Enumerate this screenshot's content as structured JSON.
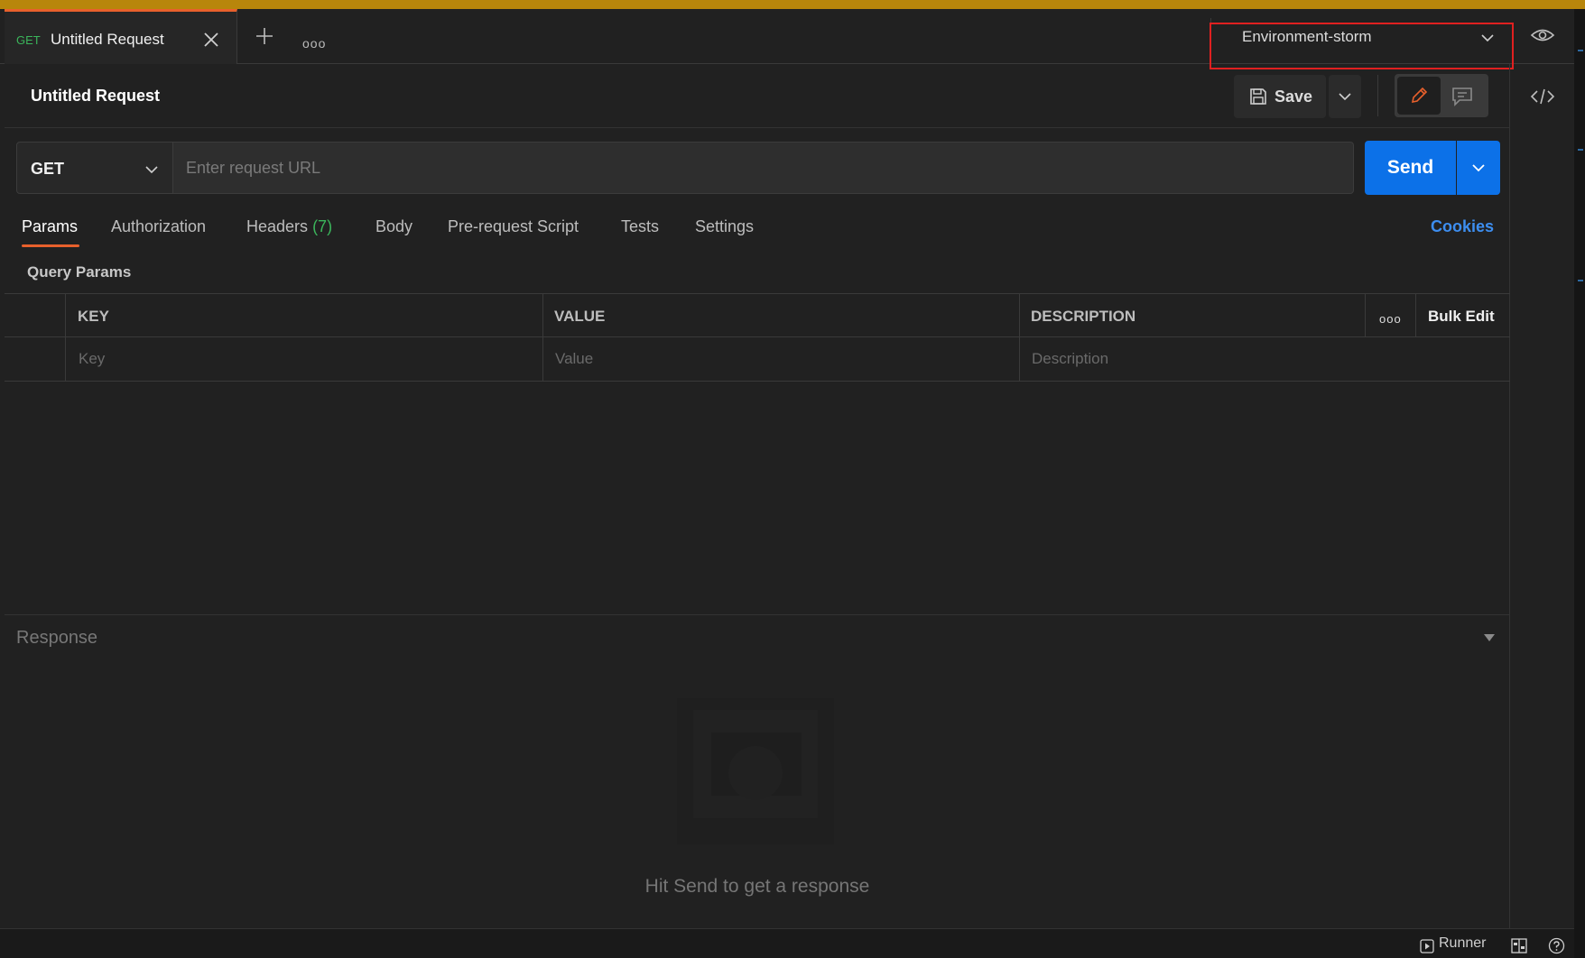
{
  "tab": {
    "method": "GET",
    "title": "Untitled Request",
    "more": "ooo"
  },
  "environment": {
    "selected": "Environment-storm"
  },
  "request": {
    "title": "Untitled Request",
    "save_label": "Save",
    "method": "GET",
    "url_placeholder": "Enter request URL",
    "url_value": "",
    "send_label": "Send"
  },
  "subtabs": {
    "params": "Params",
    "authorization": "Authorization",
    "headers": "Headers",
    "headers_count": "(7)",
    "body": "Body",
    "prerequest": "Pre-request Script",
    "tests": "Tests",
    "settings": "Settings",
    "cookies": "Cookies"
  },
  "query_params": {
    "label": "Query Params",
    "columns": {
      "key": "KEY",
      "value": "VALUE",
      "description": "DESCRIPTION",
      "more": "ooo",
      "bulk_edit": "Bulk Edit"
    },
    "placeholders": {
      "key": "Key",
      "value": "Value",
      "description": "Description"
    }
  },
  "response": {
    "label": "Response",
    "hint": "Hit Send to get a response"
  },
  "statusbar": {
    "runner": "Runner"
  },
  "colors": {
    "accent": "#e8602c",
    "send": "#0c71e8",
    "get": "#3bb55b",
    "link": "#3d8ef0",
    "highlight": "#e02020",
    "topbar": "#b8860b"
  }
}
